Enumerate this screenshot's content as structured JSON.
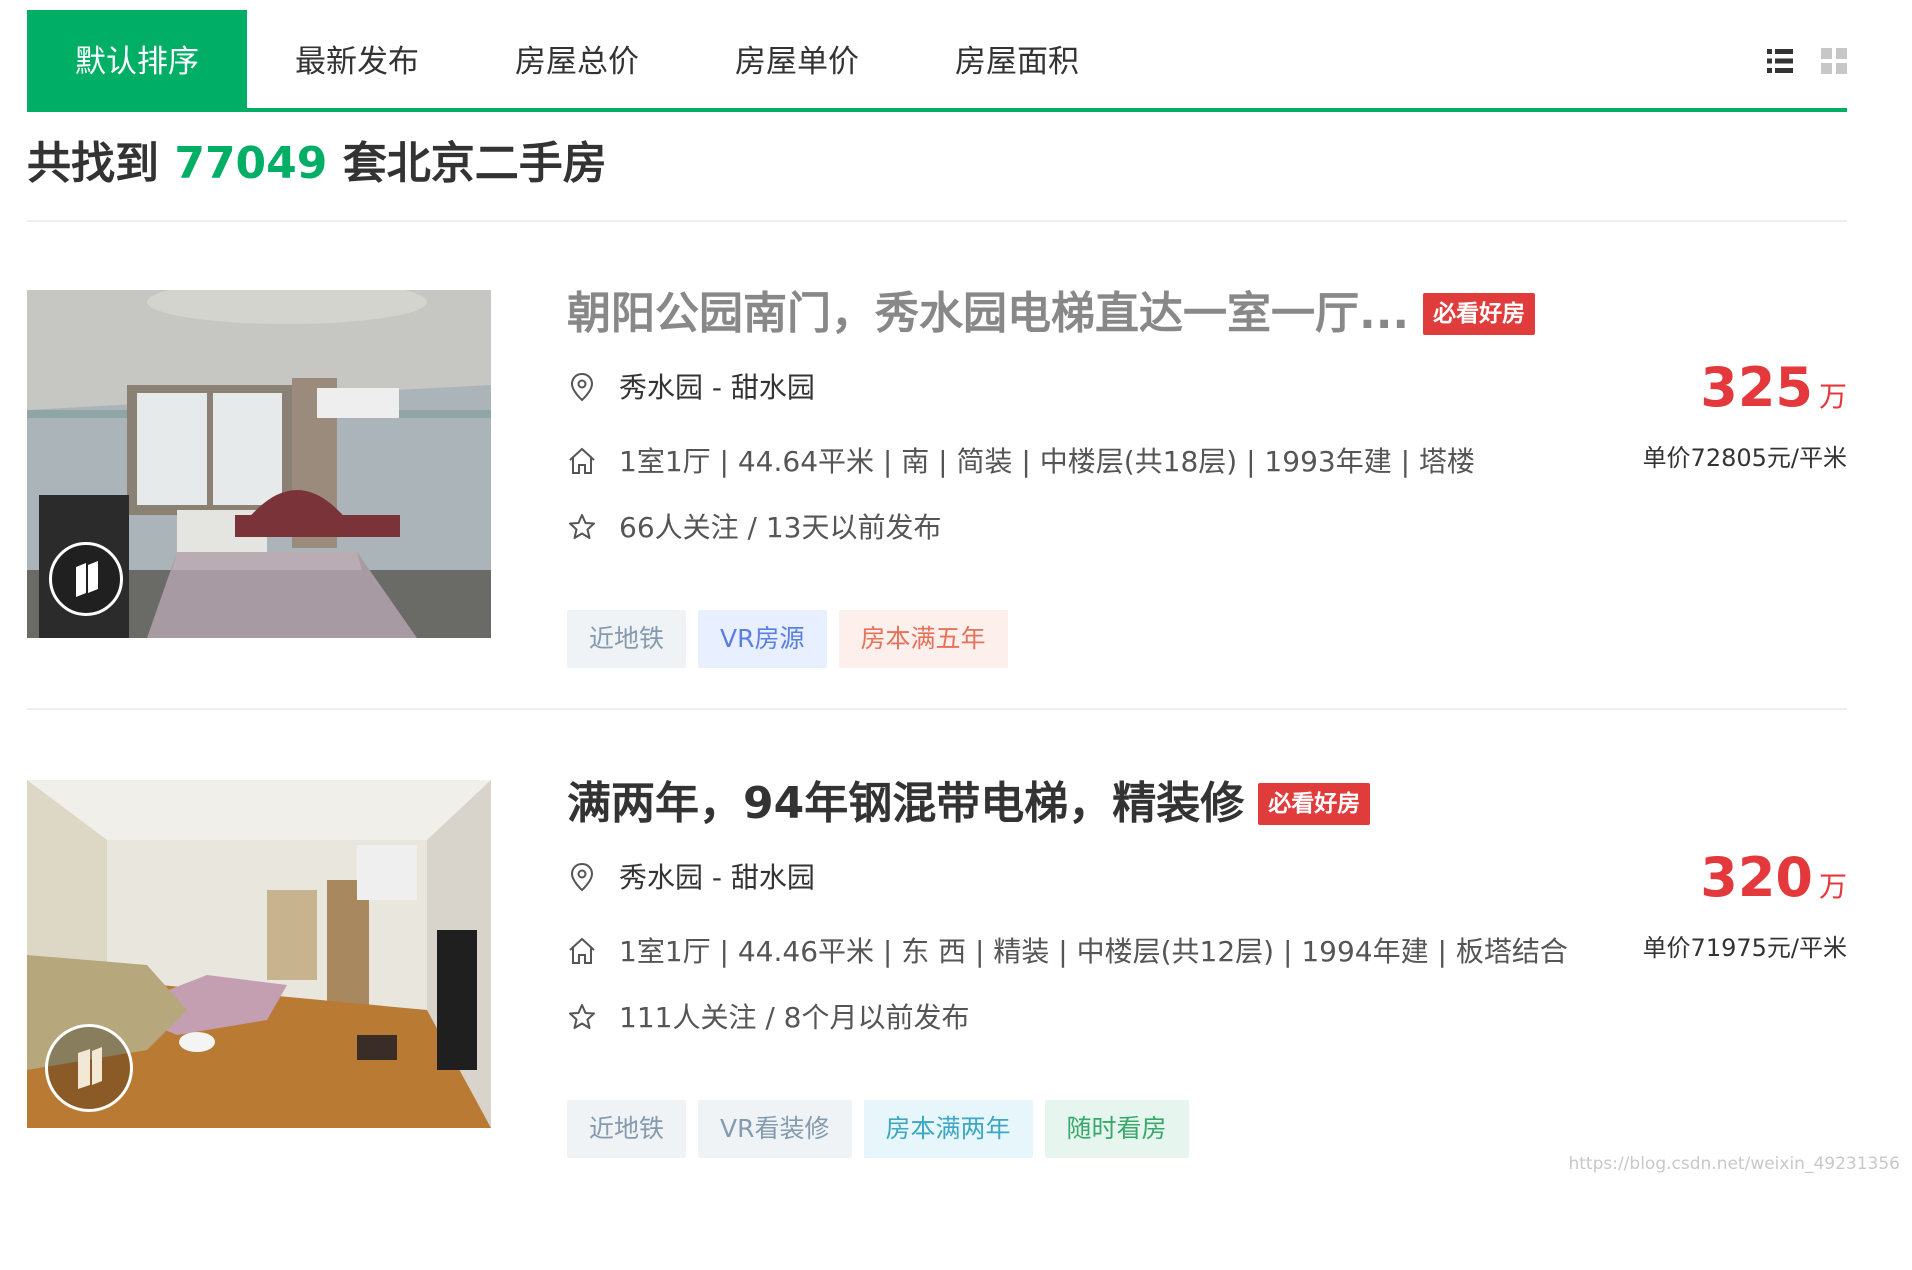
{
  "sort_tabs": [
    {
      "label": "默认排序",
      "active": true
    },
    {
      "label": "最新发布",
      "active": false
    },
    {
      "label": "房屋总价",
      "active": false
    },
    {
      "label": "房屋单价",
      "active": false
    },
    {
      "label": "房屋面积",
      "active": false
    }
  ],
  "view_modes": [
    "list-view-icon",
    "grid-view-icon"
  ],
  "summary": {
    "prefix": "共找到",
    "count": "77049",
    "suffix": "套北京二手房"
  },
  "listings": [
    {
      "title": "朝阳公园南门，秀水园电梯直达一室一厅...",
      "title_color": "#888888",
      "badge": "必看好房",
      "location": "秀水园 - 甜水园",
      "house_info": "1室1厅 | 44.64平米 | 南 | 简装 | 中楼层(共18层) | 1993年建 | 塔楼",
      "follow_info": "66人关注 / 13天以前发布",
      "total_price": "325",
      "price_unit": "万",
      "unit_price": "单价72805元/平米",
      "tags": [
        {
          "label": "近地铁",
          "bg": "#f0f3f5",
          "color": "#849aae"
        },
        {
          "label": "VR房源",
          "bg": "#e8efff",
          "color": "#5a7fe0"
        },
        {
          "label": "房本满五年",
          "bg": "#fdefec",
          "color": "#e5735b"
        }
      ]
    },
    {
      "title": "满两年，94年钢混带电梯，精装修",
      "title_color": "#333333",
      "badge": "必看好房",
      "location": "秀水园 - 甜水园",
      "house_info": "1室1厅 | 44.46平米 | 东 西 | 精装 | 中楼层(共12层) | 1994年建 | 板塔结合",
      "follow_info": "111人关注 / 8个月以前发布",
      "total_price": "320",
      "price_unit": "万",
      "unit_price": "单价71975元/平米",
      "tags": [
        {
          "label": "近地铁",
          "bg": "#f0f3f5",
          "color": "#849aae"
        },
        {
          "label": "VR看装修",
          "bg": "#f0f3f5",
          "color": "#849aae"
        },
        {
          "label": "房本满两年",
          "bg": "#e6f6fa",
          "color": "#3fa7c3"
        },
        {
          "label": "随时看房",
          "bg": "#e6f6ee",
          "color": "#38a86a"
        }
      ]
    }
  ],
  "watermark": "https://blog.csdn.net/weixin_49231356"
}
